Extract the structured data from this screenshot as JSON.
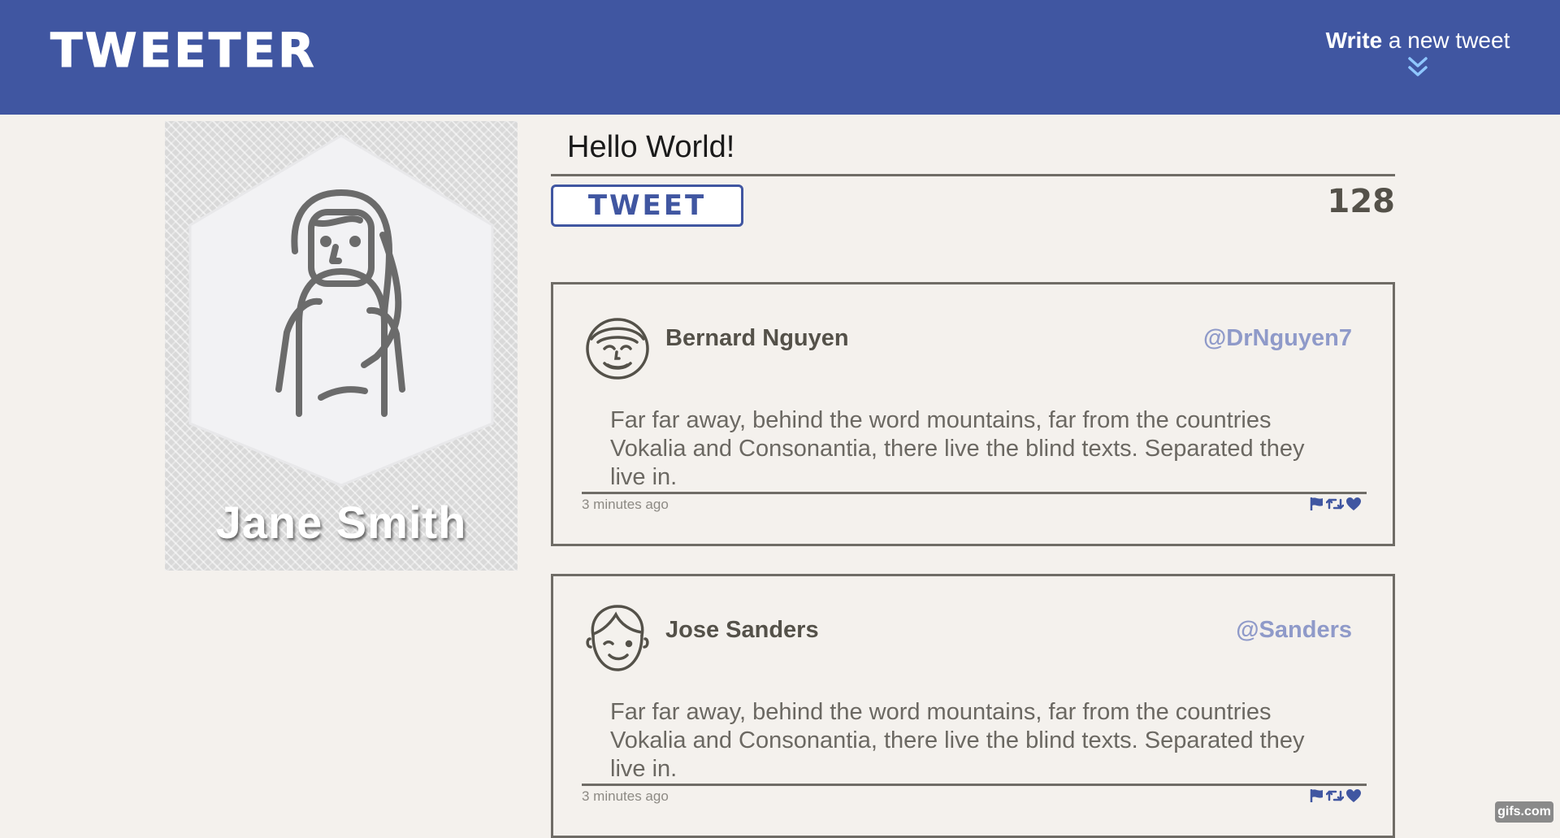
{
  "header": {
    "brand": "TWEETER",
    "compose_toggle": {
      "bold": "Write",
      "rest": "a new tweet",
      "icon": "double-chevron-down-icon"
    }
  },
  "profile": {
    "name": "Jane Smith",
    "avatar_icon": "woman-avatar-icon"
  },
  "composer": {
    "value": "Hello World!",
    "button_label": "TWEET",
    "counter": "128"
  },
  "tweets": [
    {
      "author": "Bernard Nguyen",
      "handle": "@DrNguyen7",
      "body": "Far far away, behind the word mountains, far from the countries Vokalia and Consonantia, there live the blind texts. Separated they live in.",
      "timestamp": "3 minutes ago",
      "avatar_icon": "smiling-man-avatar-icon",
      "actions": [
        "flag-icon",
        "retweet-icon",
        "heart-icon"
      ]
    },
    {
      "author": "Jose Sanders",
      "handle": "@Sanders",
      "body": "Far far away, behind the word mountains, far from the countries Vokalia and Consonantia, there live the blind texts. Separated they live in.",
      "timestamp": "3 minutes ago",
      "avatar_icon": "winking-boy-avatar-icon",
      "actions": [
        "flag-icon",
        "retweet-icon",
        "heart-icon"
      ]
    }
  ],
  "watermark": "gifs.com",
  "colors": {
    "brand_blue": "#4056a1",
    "background": "#f4f1ed",
    "text": "#545149",
    "handle": "#8f9ac9"
  }
}
